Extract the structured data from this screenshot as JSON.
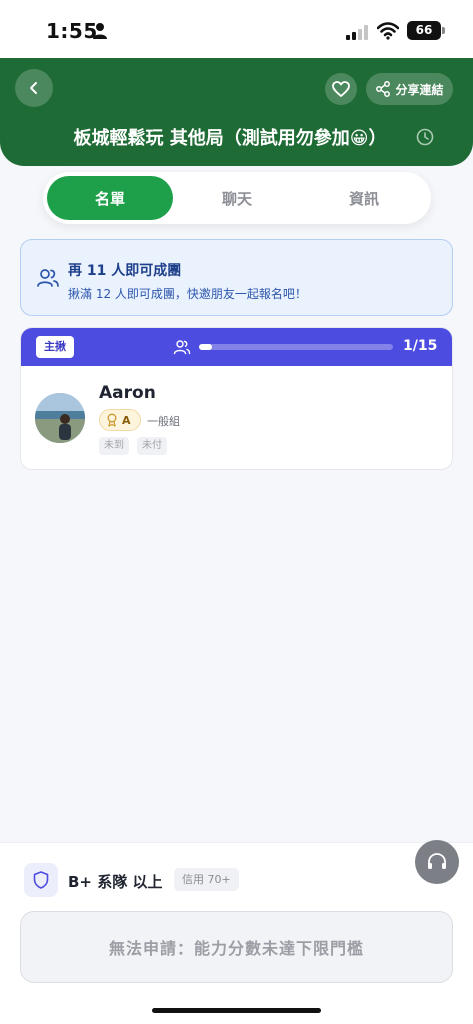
{
  "status_bar": {
    "time": "1:55",
    "battery": "66",
    "signal_bars_active": 2,
    "signal_bars_total": 4
  },
  "header": {
    "title": "板城輕鬆玩 其他局（測試用勿參加😀）",
    "share_label": "分享連結",
    "color": "#1f6b35"
  },
  "tabs": [
    {
      "label": "名單",
      "active": true
    },
    {
      "label": "聊天",
      "active": false
    },
    {
      "label": "資訊",
      "active": false
    }
  ],
  "banner": {
    "title": "再 11 人即可成團",
    "subtitle": "揪滿 12 人即可成團，快邀朋友一起報名吧！"
  },
  "roster": {
    "host_badge": "主揪",
    "count_text": "1/15",
    "progress_fraction": 0.0667,
    "members": [
      {
        "name": "Aaron",
        "grade": "A",
        "group": "一般組",
        "tags": [
          "未到",
          "未付"
        ]
      }
    ]
  },
  "requirement": {
    "level": "B+ 系隊 以上",
    "credit": "信用 70+"
  },
  "apply_button": {
    "label": "無法申請：能力分數未達下限門檻",
    "enabled": false
  },
  "colors": {
    "primary_green": "#1ea04a",
    "host_purple": "#4d4ce0",
    "banner_blue": "#eaf2fd"
  }
}
